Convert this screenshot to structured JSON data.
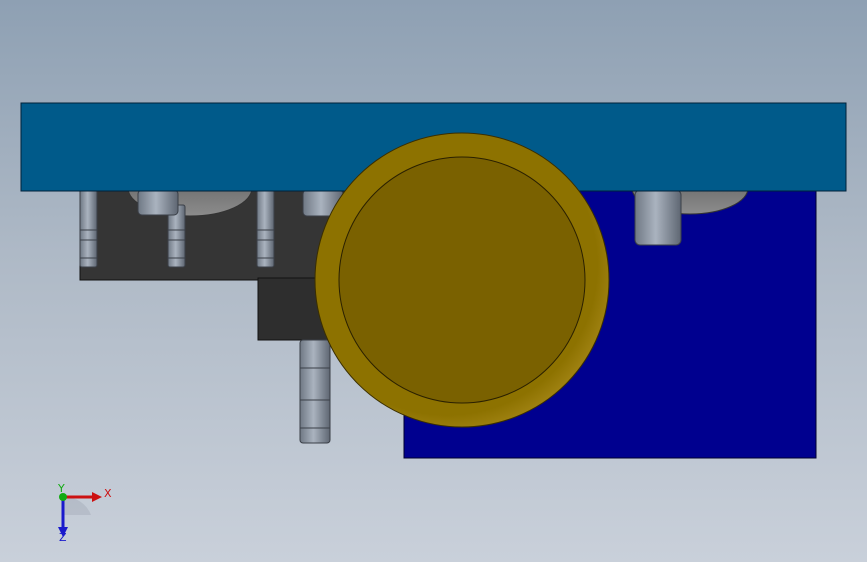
{
  "window": {
    "title": ""
  },
  "scene": {
    "background_top": "#8ea0b3",
    "background_bottom": "#c9d0da",
    "top_plate_color": "#005a8a",
    "blue_block_color": "#00008f",
    "dark_block_color": "#333333",
    "wheel_color": "#7a6100",
    "wheel_rim_color": "#9c8100",
    "peg_color": "#8a94a3",
    "caster_color": "#777777"
  },
  "triad": {
    "x_label": "X",
    "y_label": "Y",
    "z_label": "Z",
    "x_color": "#cc1111",
    "y_color": "#11aa11",
    "z_color": "#1a1acc"
  }
}
